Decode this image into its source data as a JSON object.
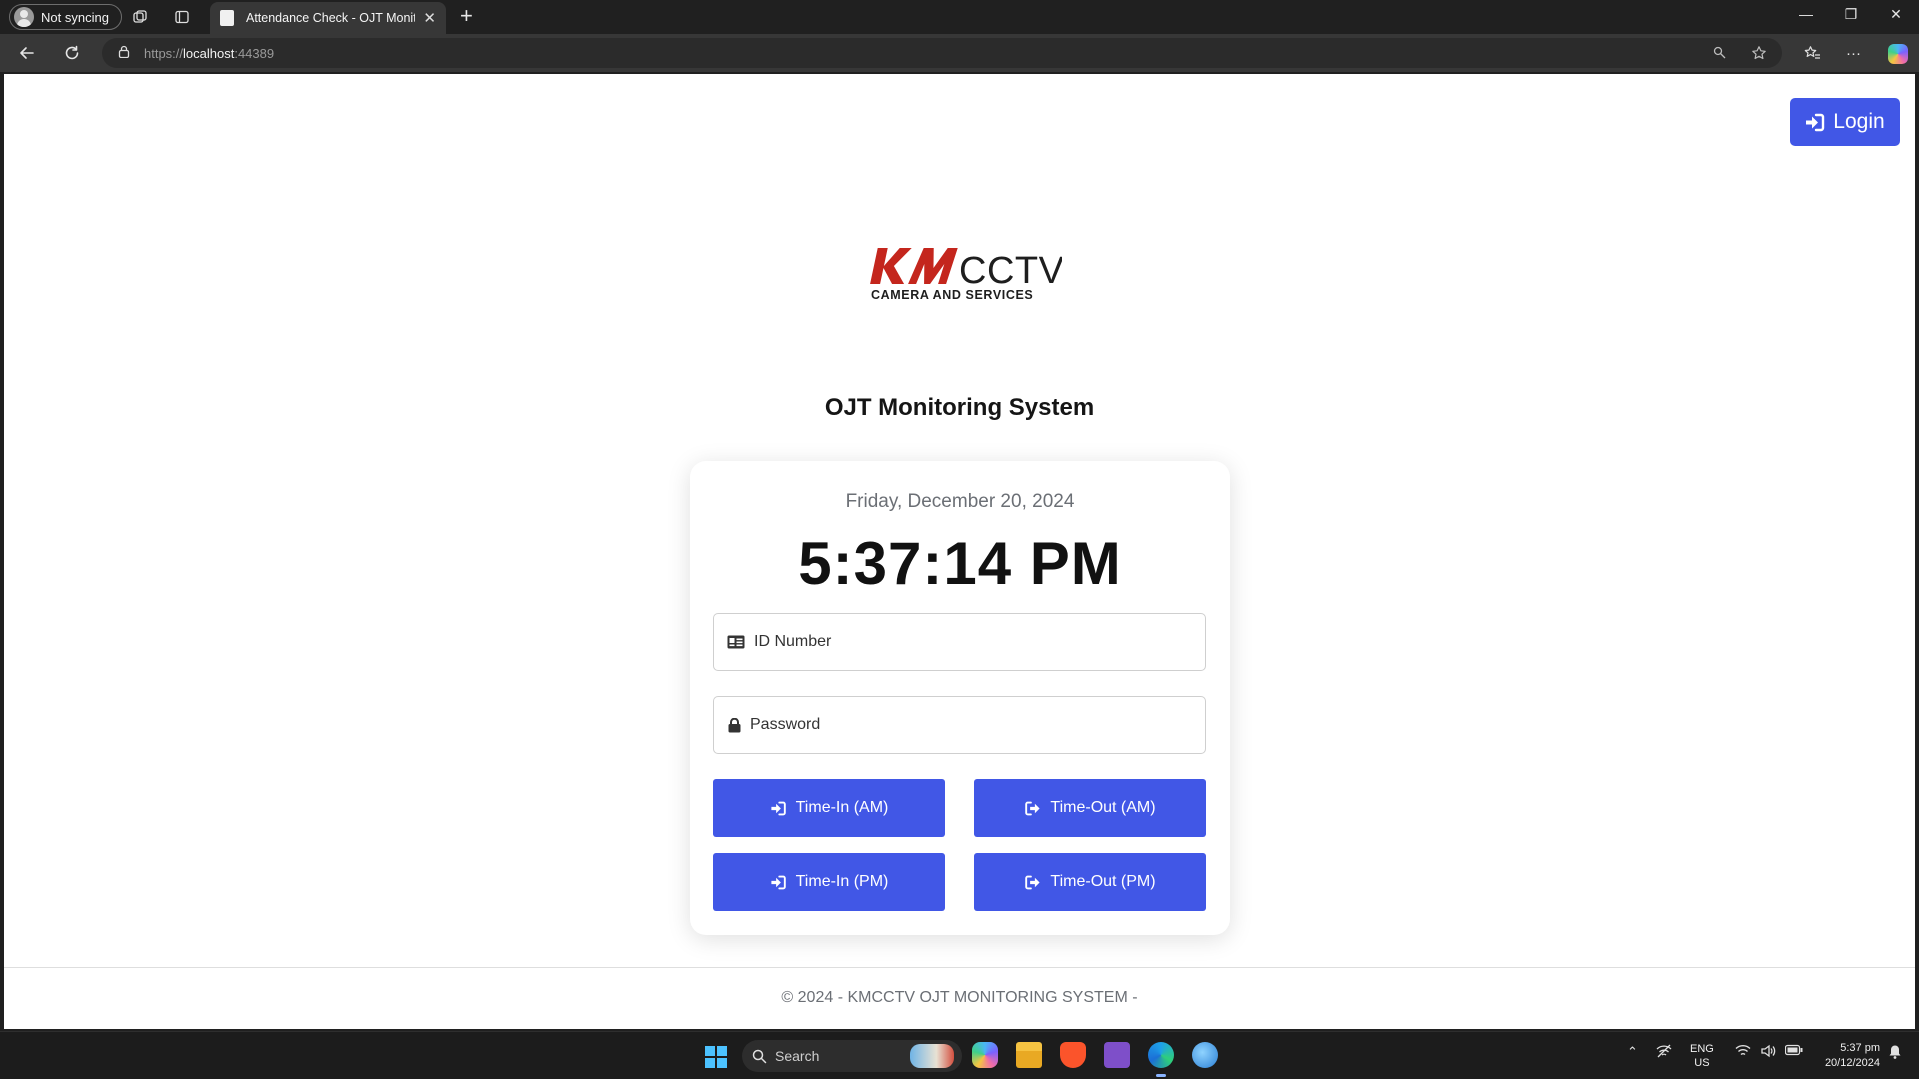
{
  "browser": {
    "profile_label": "Not syncing",
    "tab_title": "Attendance Check - OJT Monitoring",
    "url_scheme": "https://",
    "url_host": "localhost",
    "url_port": ":44389"
  },
  "page": {
    "login_label": "Login",
    "logo": {
      "brand": "KMCCTV",
      "tagline": "CAMERA AND SERVICES"
    },
    "title": "OJT Monitoring System",
    "date": "Friday, December 20, 2024",
    "time": "5:37:14 PM",
    "id_placeholder": "ID Number",
    "password_placeholder": "Password",
    "buttons": {
      "time_in_am": "Time-In (AM)",
      "time_out_am": "Time-Out (AM)",
      "time_in_pm": "Time-In (PM)",
      "time_out_pm": "Time-Out (PM)"
    },
    "footer": "© 2024 - KMCCTV OJT MONITORING SYSTEM -"
  },
  "taskbar": {
    "search_label": "Search",
    "lang_line1": "ENG",
    "lang_line2": "US",
    "clock_time": "5:37 pm",
    "clock_date": "20/12/2024"
  },
  "colors": {
    "primary": "#4157e6",
    "logo_red": "#c4261d",
    "logo_dark": "#1e1e1e"
  }
}
